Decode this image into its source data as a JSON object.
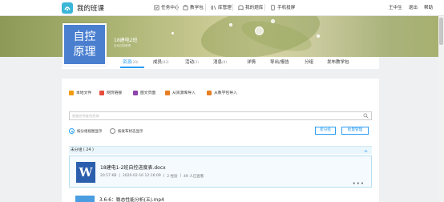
{
  "brand": {
    "name": "我的班课"
  },
  "nav": {
    "items": [
      {
        "label": "任务中心",
        "icon": "task-icon"
      },
      {
        "label": "教学包",
        "icon": "package-icon"
      },
      {
        "label": "库管理",
        "icon": "library-icon"
      },
      {
        "label": "我的题库",
        "icon": "question-bank-icon"
      },
      {
        "label": "手机投屏",
        "icon": "phone-cast-icon"
      }
    ],
    "user_name": "王中生",
    "logout": "退出",
    "help": "帮助"
  },
  "course": {
    "cover_line1": "自控",
    "cover_line2": "原理",
    "class_name": "18建电2班",
    "class_sub": "自动控制原理"
  },
  "tabs": [
    {
      "label": "资源",
      "count": "(29)",
      "active": true
    },
    {
      "label": "成员",
      "count": "(83)"
    },
    {
      "label": "活动",
      "count": "(2)"
    },
    {
      "label": "消息",
      "count": "(8)"
    },
    {
      "label": "详情",
      "count": ""
    },
    {
      "label": "导出/报告",
      "count": ""
    },
    {
      "label": "分组",
      "count": ""
    },
    {
      "label": "发布教学包",
      "count": ""
    }
  ],
  "tools": [
    {
      "label": "本地文件",
      "color": "#f39c12"
    },
    {
      "label": "网页链接",
      "color": "#e74c3c"
    },
    {
      "label": "图文页面",
      "color": "#8e44ad"
    },
    {
      "label": "从资源库导入",
      "color": "#e67e22"
    },
    {
      "label": "从教学包导入",
      "color": "#e67e22"
    }
  ],
  "search": {
    "placeholder": "根据名称查找资源"
  },
  "display": {
    "option1": "按分组视图显示",
    "option2": "按发布状态显示",
    "btn_new_group": "新分组",
    "btn_batch": "批量管理"
  },
  "group": {
    "title": "未分组 ( 24 )"
  },
  "files": [
    {
      "name": "18建电1-2班自控进度表.docx",
      "size": "20.57 KB",
      "date": "2020-02-16 12:16:09",
      "type": "2 经验",
      "views": "49 人已查看"
    },
    {
      "name": "3.6-6：稳态性能分析(五).mp4"
    }
  ],
  "colors": {
    "accent": "#2a9df4",
    "word_blue": "#2b5fad",
    "cover_blue": "#4a7fd0"
  }
}
